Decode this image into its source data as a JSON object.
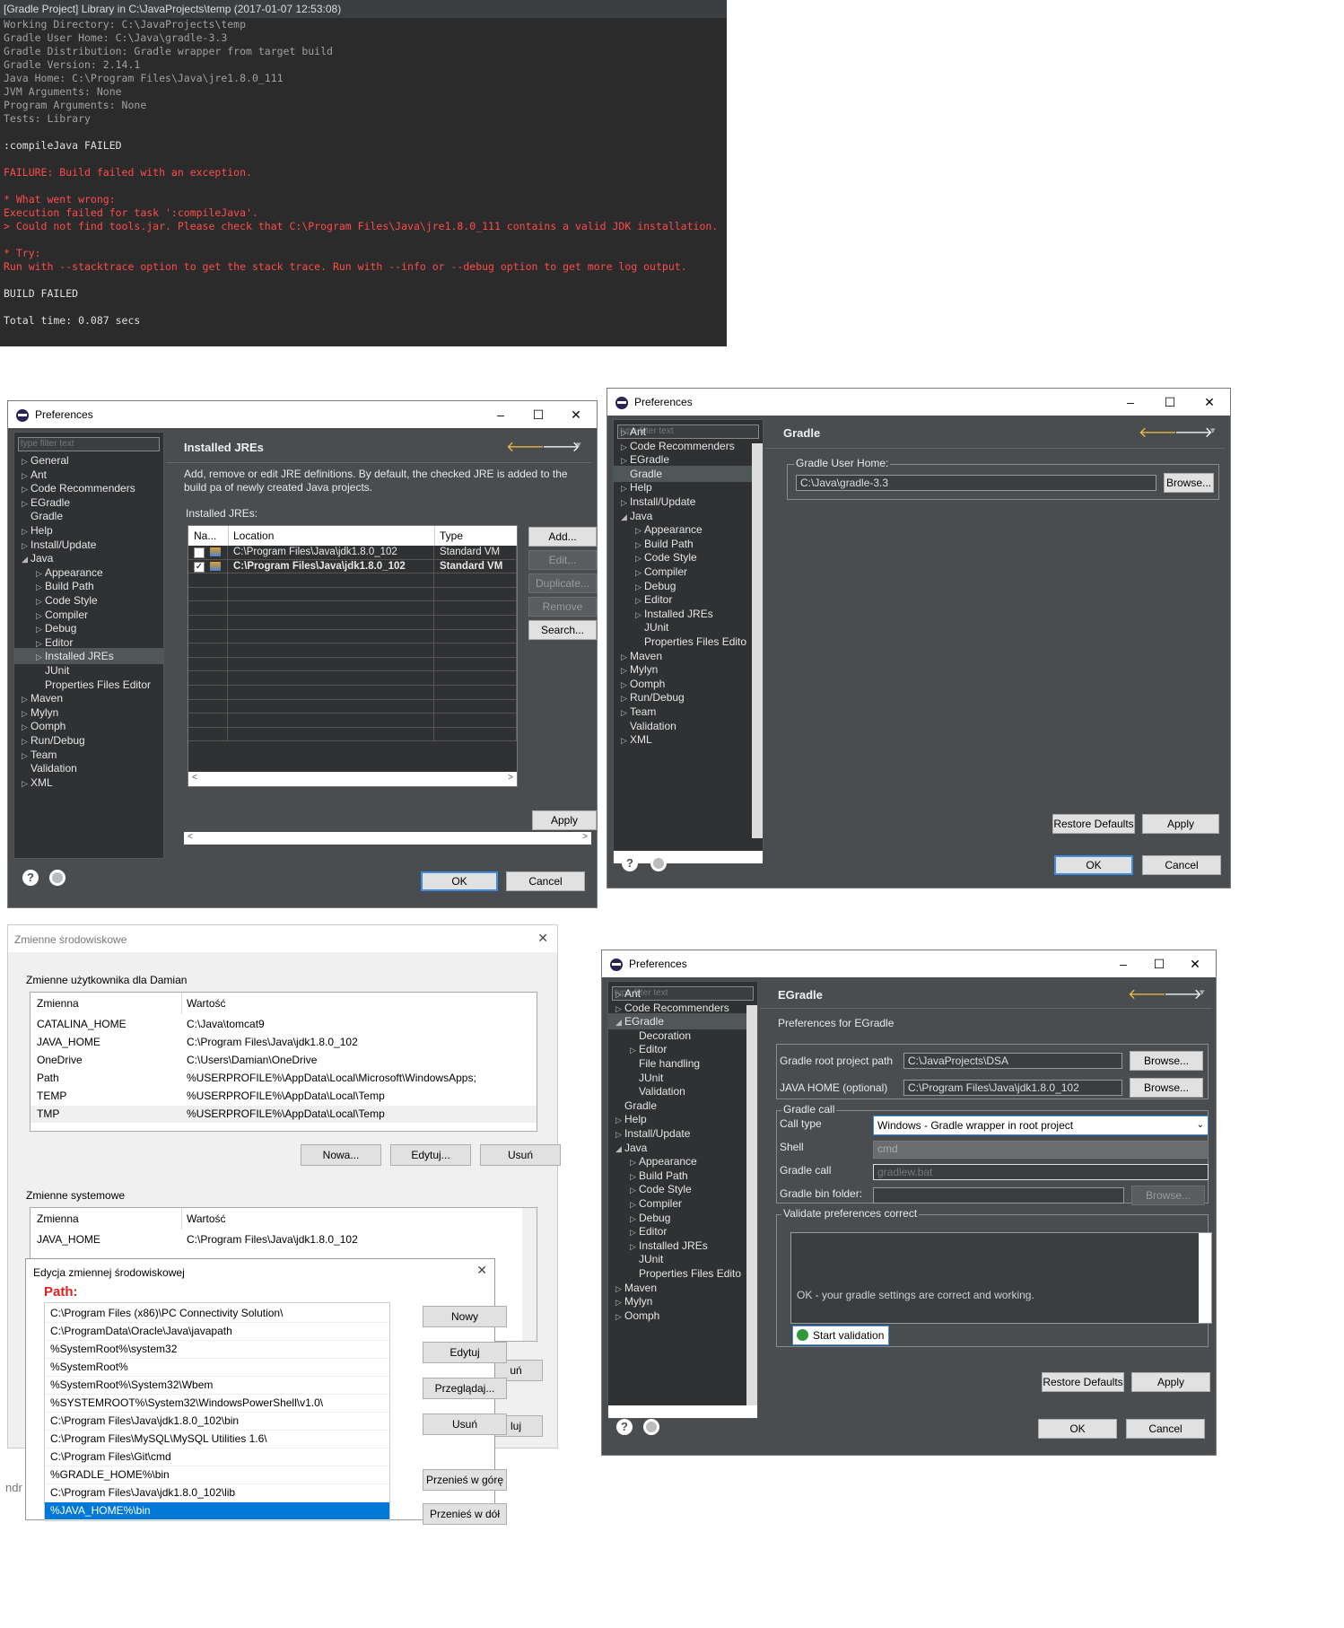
{
  "console": {
    "title": "[Gradle Project] Library in C:\\JavaProjects\\temp (2017-01-07 12:53:08)",
    "lines": [
      {
        "text": "Working Directory: C:\\JavaProjects\\temp",
        "color": "gray"
      },
      {
        "text": "Gradle User Home: C:\\Java\\gradle-3.3",
        "color": "gray"
      },
      {
        "text": "Gradle Distribution: Gradle wrapper from target build",
        "color": "gray"
      },
      {
        "text": "Gradle Version: 2.14.1",
        "color": "gray"
      },
      {
        "text": "Java Home: C:\\Program Files\\Java\\jre1.8.0_111",
        "color": "gray"
      },
      {
        "text": "JVM Arguments: None",
        "color": "gray"
      },
      {
        "text": "Program Arguments: None",
        "color": "gray"
      },
      {
        "text": "Tests: Library",
        "color": "gray"
      },
      {
        "text": "",
        "color": "gray"
      },
      {
        "text": ":compileJava FAILED",
        "color": "white"
      },
      {
        "text": "",
        "color": "gray"
      },
      {
        "text": "FAILURE: Build failed with an exception.",
        "color": "red"
      },
      {
        "text": "",
        "color": "gray"
      },
      {
        "text": "* What went wrong:",
        "color": "red"
      },
      {
        "text": "Execution failed for task ':compileJava'.",
        "color": "red"
      },
      {
        "text": "> Could not find tools.jar. Please check that C:\\Program Files\\Java\\jre1.8.0_111 contains a valid JDK installation.",
        "color": "red"
      },
      {
        "text": "",
        "color": "gray"
      },
      {
        "text": "* Try:",
        "color": "red"
      },
      {
        "text": "Run with --stacktrace option to get the stack trace. Run with --info or --debug option to get more log output.",
        "color": "red"
      },
      {
        "text": "",
        "color": "gray"
      },
      {
        "text": "BUILD FAILED",
        "color": "white"
      },
      {
        "text": "",
        "color": "gray"
      },
      {
        "text": "Total time: 0.087 secs",
        "color": "white"
      }
    ]
  },
  "common": {
    "preferences_title": "Preferences",
    "filter_placeholder": "type filter text",
    "ok": "OK",
    "cancel": "Cancel",
    "apply": "Apply",
    "restore_defaults": "Restore Defaults",
    "browse": "Browse..."
  },
  "jres_dialog": {
    "page_title": "Installed JREs",
    "description": "Add, remove or edit JRE definitions. By default, the checked JRE is added to the build pa of newly created Java projects.",
    "list_label": "Installed JREs:",
    "columns": [
      "Na...",
      "Location",
      "Type"
    ],
    "rows": [
      {
        "location": "C:\\Program Files\\Java\\jdk1.8.0_102",
        "type": "Standard VM",
        "checked": false
      },
      {
        "location": "C:\\Program Files\\Java\\jdk1.8.0_102",
        "type": "Standard VM",
        "checked": true
      }
    ],
    "buttons": [
      "Add...",
      "Edit...",
      "Duplicate...",
      "Remove",
      "Search..."
    ],
    "tree": [
      {
        "label": "General",
        "level": 0,
        "exp": "closed"
      },
      {
        "label": "Ant",
        "level": 0,
        "exp": "closed"
      },
      {
        "label": "Code Recommenders",
        "level": 0,
        "exp": "closed"
      },
      {
        "label": "EGradle",
        "level": 0,
        "exp": "closed"
      },
      {
        "label": "Gradle",
        "level": 0,
        "exp": "none"
      },
      {
        "label": "Help",
        "level": 0,
        "exp": "closed"
      },
      {
        "label": "Install/Update",
        "level": 0,
        "exp": "closed"
      },
      {
        "label": "Java",
        "level": 0,
        "exp": "open"
      },
      {
        "label": "Appearance",
        "level": 1,
        "exp": "closed"
      },
      {
        "label": "Build Path",
        "level": 1,
        "exp": "closed"
      },
      {
        "label": "Code Style",
        "level": 1,
        "exp": "closed"
      },
      {
        "label": "Compiler",
        "level": 1,
        "exp": "closed"
      },
      {
        "label": "Debug",
        "level": 1,
        "exp": "closed"
      },
      {
        "label": "Editor",
        "level": 1,
        "exp": "closed"
      },
      {
        "label": "Installed JREs",
        "level": 1,
        "exp": "closed",
        "sel": true
      },
      {
        "label": "JUnit",
        "level": 1,
        "exp": "none"
      },
      {
        "label": "Properties Files Editor",
        "level": 1,
        "exp": "none"
      },
      {
        "label": "Maven",
        "level": 0,
        "exp": "closed"
      },
      {
        "label": "Mylyn",
        "level": 0,
        "exp": "closed"
      },
      {
        "label": "Oomph",
        "level": 0,
        "exp": "closed"
      },
      {
        "label": "Run/Debug",
        "level": 0,
        "exp": "closed"
      },
      {
        "label": "Team",
        "level": 0,
        "exp": "closed"
      },
      {
        "label": "Validation",
        "level": 0,
        "exp": "none"
      },
      {
        "label": "XML",
        "level": 0,
        "exp": "closed"
      }
    ]
  },
  "gradle_dialog": {
    "page_title": "Gradle",
    "group_label": "Gradle User Home:",
    "user_home_value": "C:\\Java\\gradle-3.3",
    "tree": [
      {
        "label": "Ant",
        "level": 0,
        "exp": "closed"
      },
      {
        "label": "Code Recommenders",
        "level": 0,
        "exp": "closed"
      },
      {
        "label": "EGradle",
        "level": 0,
        "exp": "closed"
      },
      {
        "label": "Gradle",
        "level": 0,
        "exp": "none",
        "sel": true
      },
      {
        "label": "Help",
        "level": 0,
        "exp": "closed"
      },
      {
        "label": "Install/Update",
        "level": 0,
        "exp": "closed"
      },
      {
        "label": "Java",
        "level": 0,
        "exp": "open"
      },
      {
        "label": "Appearance",
        "level": 1,
        "exp": "closed"
      },
      {
        "label": "Build Path",
        "level": 1,
        "exp": "closed"
      },
      {
        "label": "Code Style",
        "level": 1,
        "exp": "closed"
      },
      {
        "label": "Compiler",
        "level": 1,
        "exp": "closed"
      },
      {
        "label": "Debug",
        "level": 1,
        "exp": "closed"
      },
      {
        "label": "Editor",
        "level": 1,
        "exp": "closed"
      },
      {
        "label": "Installed JREs",
        "level": 1,
        "exp": "closed"
      },
      {
        "label": "JUnit",
        "level": 1,
        "exp": "none"
      },
      {
        "label": "Properties Files Edito",
        "level": 1,
        "exp": "none"
      },
      {
        "label": "Maven",
        "level": 0,
        "exp": "closed"
      },
      {
        "label": "Mylyn",
        "level": 0,
        "exp": "closed"
      },
      {
        "label": "Oomph",
        "level": 0,
        "exp": "closed"
      },
      {
        "label": "Run/Debug",
        "level": 0,
        "exp": "closed"
      },
      {
        "label": "Team",
        "level": 0,
        "exp": "closed"
      },
      {
        "label": "Validation",
        "level": 0,
        "exp": "none"
      },
      {
        "label": "XML",
        "level": 0,
        "exp": "closed"
      }
    ]
  },
  "env_dialog": {
    "title": "Zmienne środowiskowe",
    "user_group": "Zmienne użytkownika dla Damian",
    "col_var": "Zmienna",
    "col_val": "Wartość",
    "user_vars": [
      {
        "name": "CATALINA_HOME",
        "value": "C:\\Java\\tomcat9"
      },
      {
        "name": "JAVA_HOME",
        "value": "C:\\Program Files\\Java\\jdk1.8.0_102"
      },
      {
        "name": "OneDrive",
        "value": "C:\\Users\\Damian\\OneDrive"
      },
      {
        "name": "Path",
        "value": "%USERPROFILE%\\AppData\\Local\\Microsoft\\WindowsApps;"
      },
      {
        "name": "TEMP",
        "value": "%USERPROFILE%\\AppData\\Local\\Temp"
      },
      {
        "name": "TMP",
        "value": "%USERPROFILE%\\AppData\\Local\\Temp"
      }
    ],
    "user_buttons": [
      "Nowa...",
      "Edytuj...",
      "Usuń"
    ],
    "system_group": "Zmienne systemowe",
    "system_vars": [
      {
        "name": "JAVA_HOME",
        "value": "C:\\Program Files\\Java\\jdk1.8.0_102"
      }
    ],
    "hidden_btn_1": "uń",
    "hidden_btn_2": "luj",
    "footer_partial": "ndr"
  },
  "edit_dialog": {
    "title": "Edycja zmiennej środowiskowej",
    "annotation": "Path:",
    "paths": [
      "C:\\Program Files (x86)\\PC Connectivity Solution\\",
      "C:\\ProgramData\\Oracle\\Java\\javapath",
      "%SystemRoot%\\system32",
      "%SystemRoot%",
      "%SystemRoot%\\System32\\Wbem",
      "%SYSTEMROOT%\\System32\\WindowsPowerShell\\v1.0\\",
      "C:\\Program Files\\Java\\jdk1.8.0_102\\bin",
      "C:\\Program Files\\MySQL\\MySQL Utilities 1.6\\",
      "C:\\Program Files\\Git\\cmd",
      "%GRADLE_HOME%\\bin",
      "C:\\Program Files\\Java\\jdk1.8.0_102\\lib",
      "%JAVA_HOME%\\bin"
    ],
    "buttons": [
      "Nowy",
      "Edytuj",
      "Przeglądaj...",
      "Usuń",
      "Przenieś w górę",
      "Przenieś w dół"
    ]
  },
  "egradle_dialog": {
    "page_title": "EGradle",
    "subtitle": "Preferences for EGradle",
    "root_path_label": "Gradle root project path",
    "root_path_value": "C:\\JavaProjects\\DSA",
    "java_home_label": "JAVA HOME (optional)",
    "java_home_value": "C:\\Program Files\\Java\\jdk1.8.0_102",
    "call_group": "Gradle call",
    "call_type_label": "Call type",
    "call_type_value": "Windows - Gradle wrapper in root project",
    "shell_label": "Shell",
    "shell_value": "cmd",
    "gradle_call_label": "Gradle call",
    "gradle_call_value": "gradlew.bat",
    "bin_folder_label": "Gradle bin folder:",
    "bin_folder_btn": "Browse...",
    "validate_group": "Validate preferences correct",
    "validate_output": "OK - your gradle settings are correct and working.",
    "start_validation": "Start validation",
    "tree": [
      {
        "label": "Ant",
        "level": 0,
        "exp": "closed"
      },
      {
        "label": "Code Recommenders",
        "level": 0,
        "exp": "closed"
      },
      {
        "label": "EGradle",
        "level": 0,
        "exp": "open",
        "sel": true
      },
      {
        "label": "Decoration",
        "level": 1,
        "exp": "none"
      },
      {
        "label": "Editor",
        "level": 1,
        "exp": "closed"
      },
      {
        "label": "File handling",
        "level": 1,
        "exp": "none"
      },
      {
        "label": "JUnit",
        "level": 1,
        "exp": "none"
      },
      {
        "label": "Validation",
        "level": 1,
        "exp": "none"
      },
      {
        "label": "Gradle",
        "level": 0,
        "exp": "none"
      },
      {
        "label": "Help",
        "level": 0,
        "exp": "closed"
      },
      {
        "label": "Install/Update",
        "level": 0,
        "exp": "closed"
      },
      {
        "label": "Java",
        "level": 0,
        "exp": "open"
      },
      {
        "label": "Appearance",
        "level": 1,
        "exp": "closed"
      },
      {
        "label": "Build Path",
        "level": 1,
        "exp": "closed"
      },
      {
        "label": "Code Style",
        "level": 1,
        "exp": "closed"
      },
      {
        "label": "Compiler",
        "level": 1,
        "exp": "closed"
      },
      {
        "label": "Debug",
        "level": 1,
        "exp": "closed"
      },
      {
        "label": "Editor",
        "level": 1,
        "exp": "closed"
      },
      {
        "label": "Installed JREs",
        "level": 1,
        "exp": "closed"
      },
      {
        "label": "JUnit",
        "level": 1,
        "exp": "none"
      },
      {
        "label": "Properties Files Edito",
        "level": 1,
        "exp": "none"
      },
      {
        "label": "Maven",
        "level": 0,
        "exp": "closed"
      },
      {
        "label": "Mylyn",
        "level": 0,
        "exp": "closed"
      },
      {
        "label": "Oomph",
        "level": 0,
        "exp": "closed"
      }
    ]
  }
}
